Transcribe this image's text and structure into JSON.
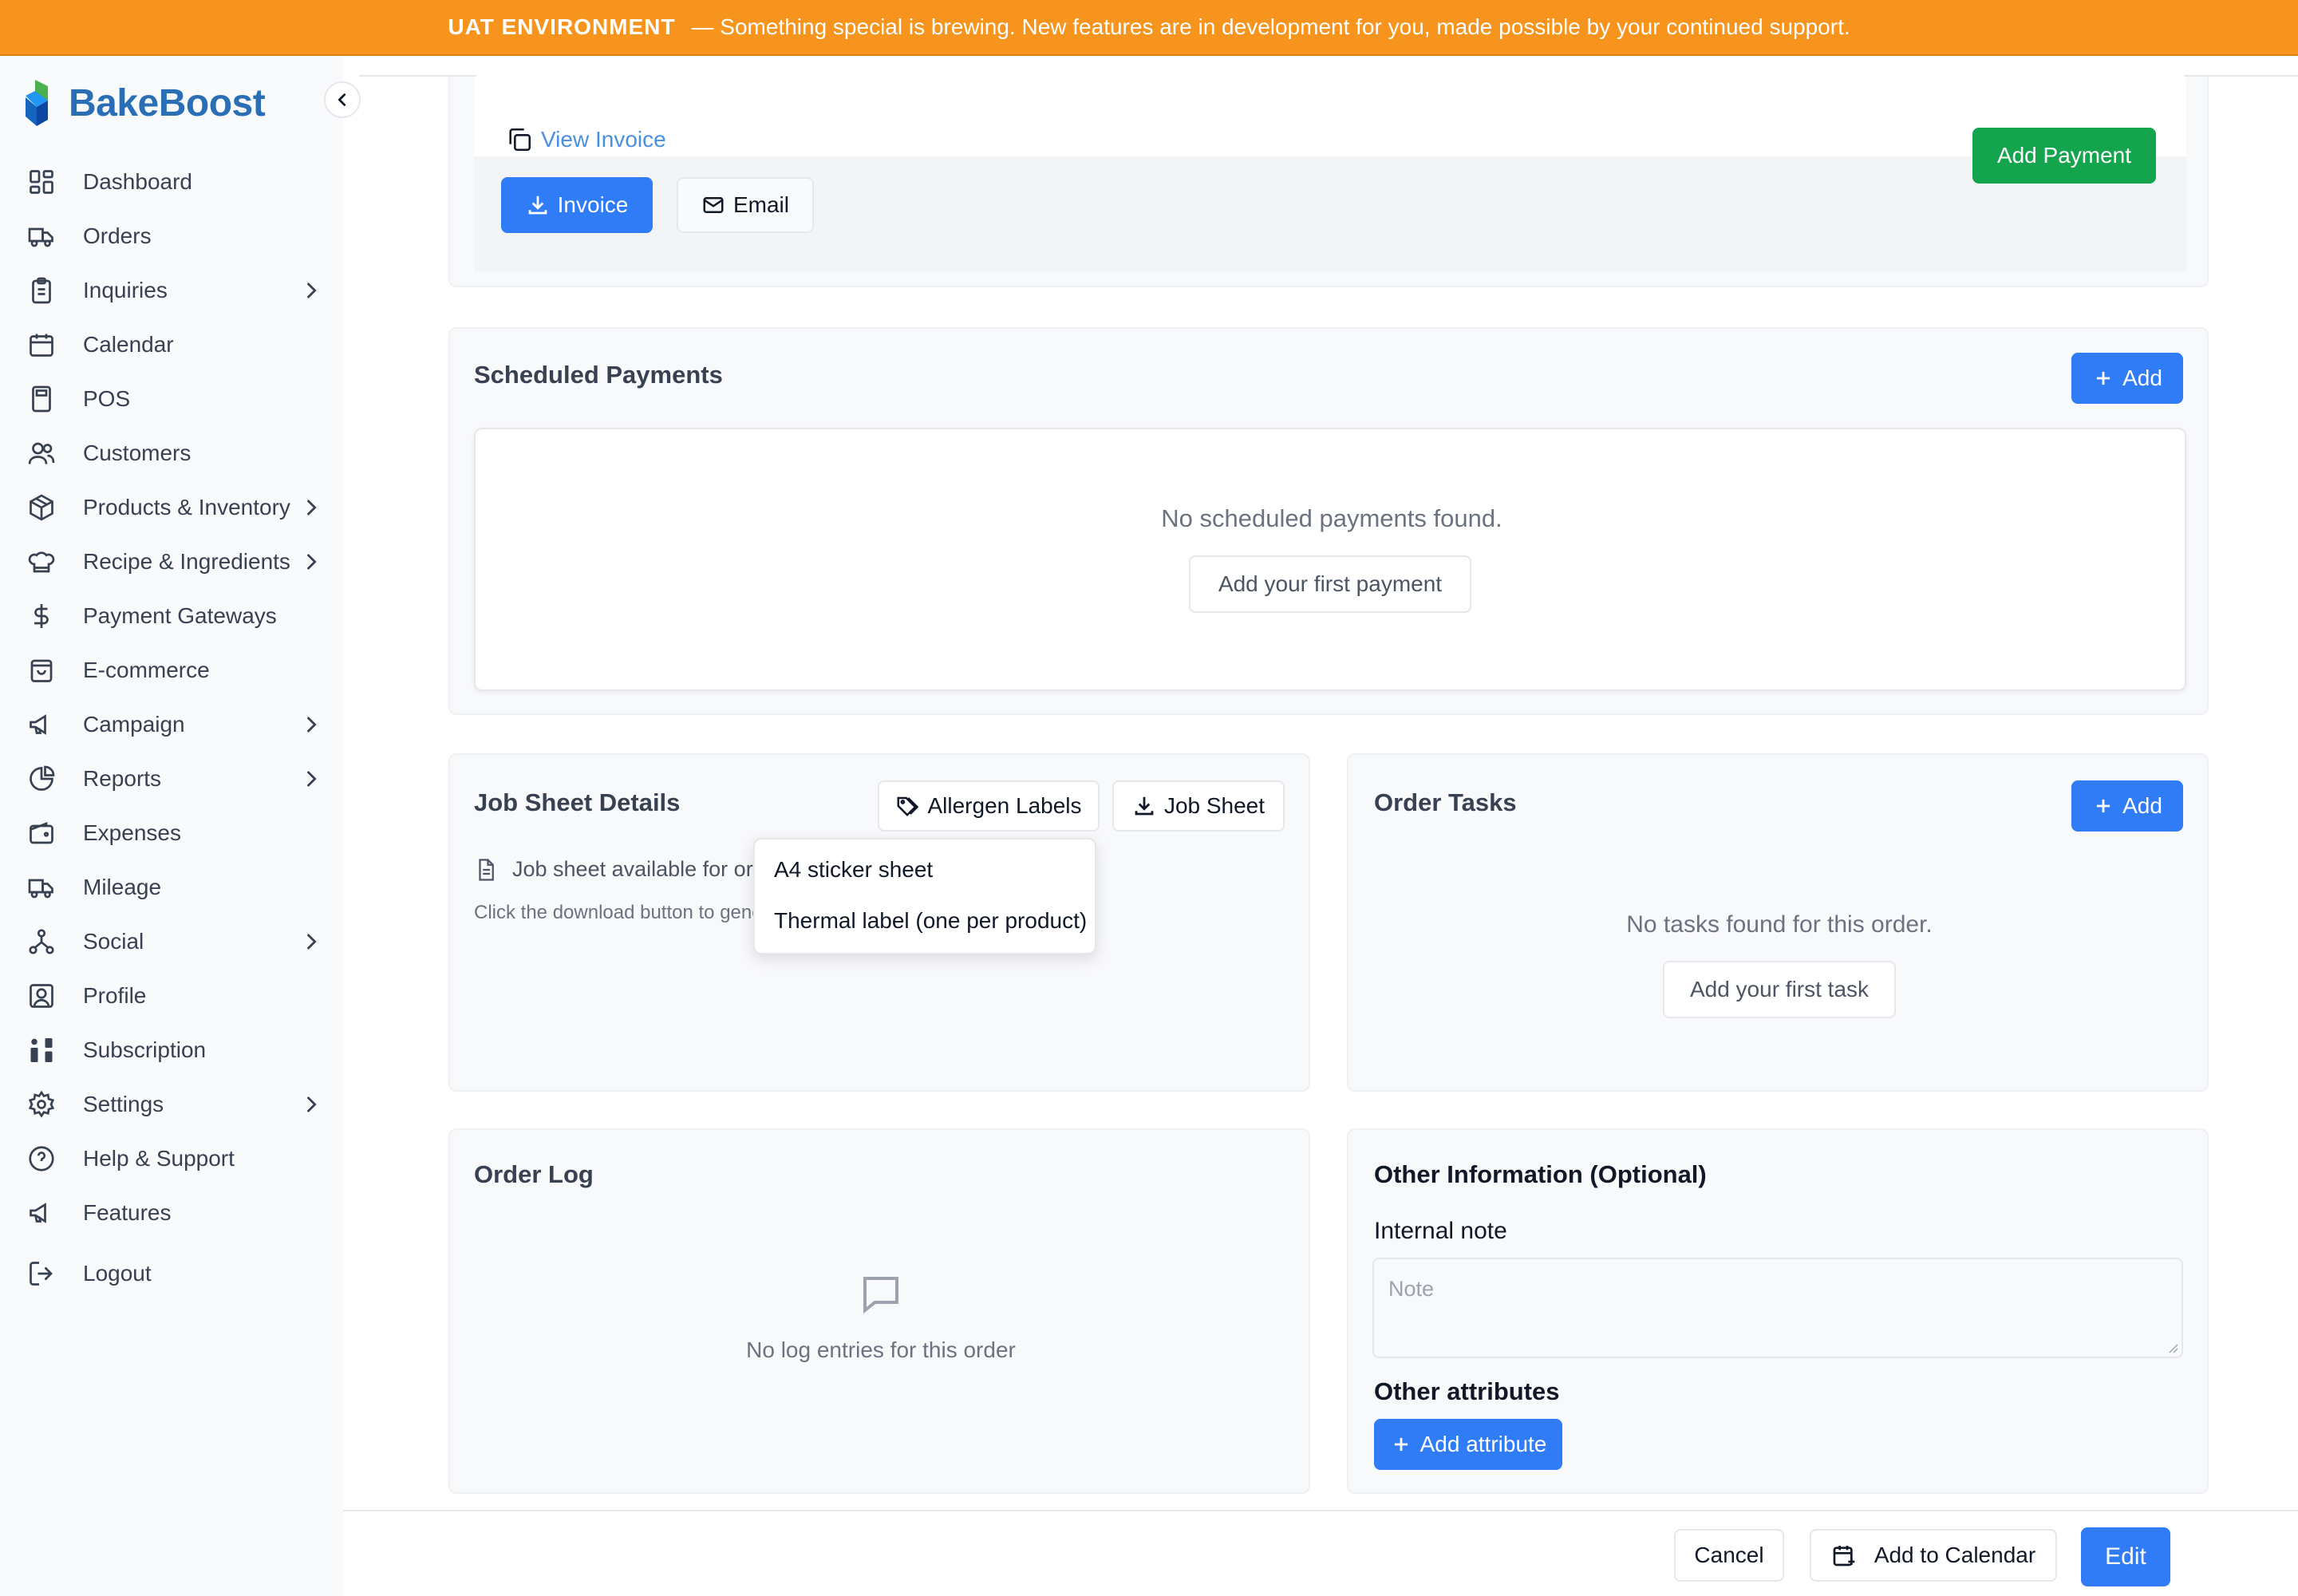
{
  "banner": {
    "tag": "UAT ENVIRONMENT",
    "message": "— Something special is brewing. New features are in development for you, made possible by your continued support.",
    "color": "#f7941d"
  },
  "app": {
    "name": "BakeBoost",
    "brand_color": "#2a6fb5"
  },
  "sidebar": {
    "items": [
      {
        "label": "Dashboard",
        "icon": "dashboard-icon"
      },
      {
        "label": "Orders",
        "icon": "truck-icon"
      },
      {
        "label": "Inquiries",
        "icon": "clipboard-icon",
        "has_submenu": true
      },
      {
        "label": "Calendar",
        "icon": "calendar-icon"
      },
      {
        "label": "POS",
        "icon": "calculator-icon"
      },
      {
        "label": "Customers",
        "icon": "users-icon"
      },
      {
        "label": "Products & Inventory",
        "icon": "box-icon",
        "has_submenu": true
      },
      {
        "label": "Recipe & Ingredients",
        "icon": "chef-hat-icon",
        "has_submenu": true
      },
      {
        "label": "Payment Gateways",
        "icon": "dollar-icon"
      },
      {
        "label": "E-commerce",
        "icon": "shopping-bag-icon"
      },
      {
        "label": "Campaign",
        "icon": "megaphone-icon",
        "has_submenu": true
      },
      {
        "label": "Reports",
        "icon": "pie-chart-icon",
        "has_submenu": true
      },
      {
        "label": "Expenses",
        "icon": "wallet-icon"
      },
      {
        "label": "Mileage",
        "icon": "truck-icon"
      },
      {
        "label": "Social",
        "icon": "share-icon",
        "has_submenu": true
      },
      {
        "label": "Profile",
        "icon": "profile-icon"
      },
      {
        "label": "Subscription",
        "icon": "sort-icon"
      },
      {
        "label": "Settings",
        "icon": "gear-icon",
        "has_submenu": true
      },
      {
        "label": "Help & Support",
        "icon": "help-icon"
      },
      {
        "label": "Features",
        "icon": "megaphone-icon"
      },
      {
        "label": "Logout",
        "icon": "logout-icon"
      }
    ]
  },
  "invoice_section": {
    "view_invoice": "View Invoice",
    "invoice_button": "Invoice",
    "email_button": "Email",
    "add_payment_button": "Add Payment"
  },
  "scheduled_payments": {
    "title": "Scheduled Payments",
    "add_button": "Add",
    "empty_text": "No scheduled payments found.",
    "first_button": "Add your first payment"
  },
  "job_sheet": {
    "title": "Job Sheet Details",
    "allergen_button": "Allergen Labels",
    "job_sheet_button": "Job Sheet",
    "available_text": "Job sheet available for or",
    "hint_text": "Click the download button to gene",
    "dropdown_options": [
      "A4 sticker sheet",
      "Thermal label (one per product)"
    ]
  },
  "order_tasks": {
    "title": "Order Tasks",
    "add_button": "Add",
    "empty_text": "No tasks found for this order.",
    "first_button": "Add your first task"
  },
  "order_log": {
    "title": "Order Log",
    "empty_text": "No log entries for this order"
  },
  "other_info": {
    "title": "Other Information (Optional)",
    "note_label": "Internal note",
    "note_placeholder": "Note",
    "attributes_label": "Other attributes",
    "add_attribute_button": "Add attribute"
  },
  "footer": {
    "cancel": "Cancel",
    "add_to_calendar": "Add to Calendar",
    "edit": "Edit"
  },
  "colors": {
    "primary": "#2f7cf6",
    "success": "#14a44d"
  }
}
